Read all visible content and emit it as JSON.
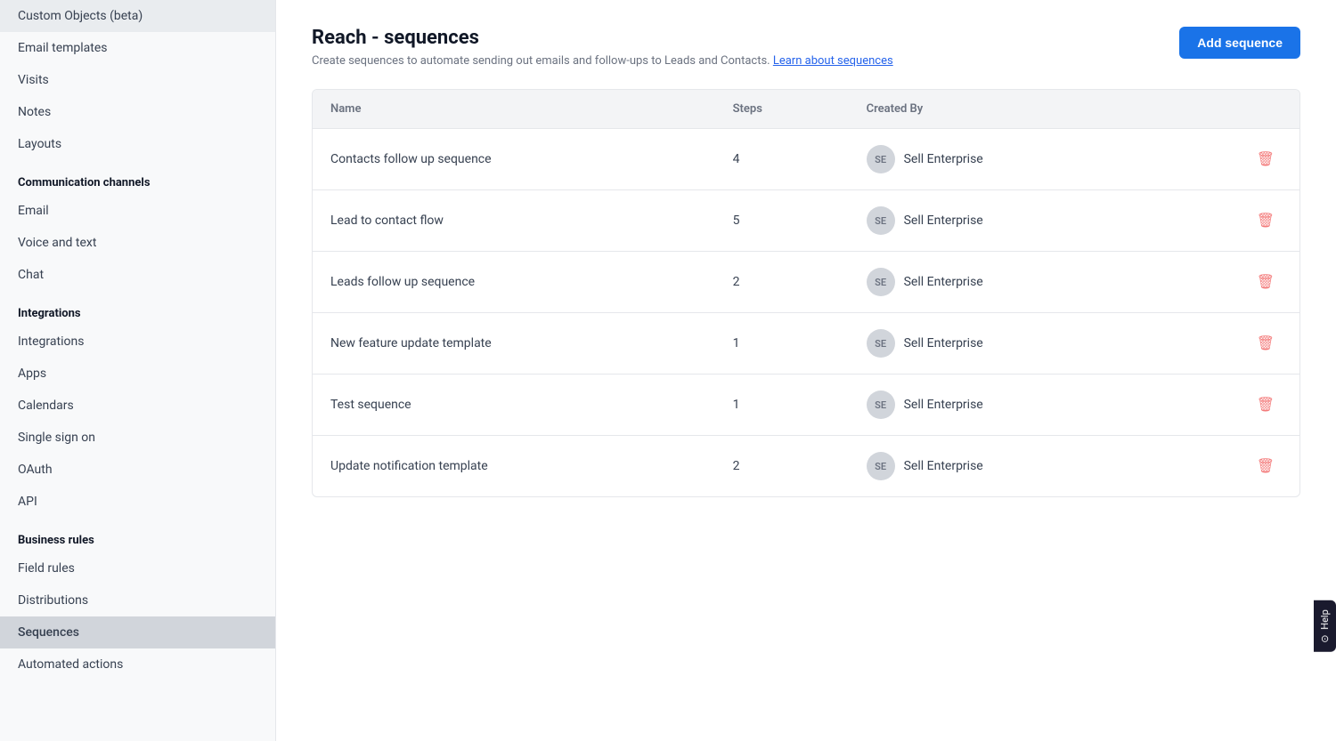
{
  "sidebar": {
    "items_top": [
      {
        "id": "custom-objects",
        "label": "Custom Objects (beta)",
        "active": false
      },
      {
        "id": "email-templates",
        "label": "Email templates",
        "active": false
      },
      {
        "id": "visits",
        "label": "Visits",
        "active": false
      },
      {
        "id": "notes",
        "label": "Notes",
        "active": false
      },
      {
        "id": "layouts",
        "label": "Layouts",
        "active": false
      }
    ],
    "sections": [
      {
        "id": "communication-channels",
        "label": "Communication channels",
        "items": [
          {
            "id": "email",
            "label": "Email",
            "active": false
          },
          {
            "id": "voice-and-text",
            "label": "Voice and text",
            "active": false
          },
          {
            "id": "chat",
            "label": "Chat",
            "active": false
          }
        ]
      },
      {
        "id": "integrations",
        "label": "Integrations",
        "items": [
          {
            "id": "integrations",
            "label": "Integrations",
            "active": false
          },
          {
            "id": "apps",
            "label": "Apps",
            "active": false
          },
          {
            "id": "calendars",
            "label": "Calendars",
            "active": false
          },
          {
            "id": "single-sign-on",
            "label": "Single sign on",
            "active": false
          },
          {
            "id": "oauth",
            "label": "OAuth",
            "active": false
          },
          {
            "id": "api",
            "label": "API",
            "active": false
          }
        ]
      },
      {
        "id": "business-rules",
        "label": "Business rules",
        "items": [
          {
            "id": "field-rules",
            "label": "Field rules",
            "active": false
          },
          {
            "id": "distributions",
            "label": "Distributions",
            "active": false
          },
          {
            "id": "sequences",
            "label": "Sequences",
            "active": true
          },
          {
            "id": "automated-actions",
            "label": "Automated actions",
            "active": false
          }
        ]
      }
    ]
  },
  "page": {
    "title": "Reach - sequences",
    "description": "Create sequences to automate sending out emails and follow-ups to Leads and Contacts.",
    "learn_link_text": "Learn about sequences",
    "add_button_label": "Add sequence"
  },
  "table": {
    "columns": [
      {
        "id": "name",
        "label": "Name"
      },
      {
        "id": "steps",
        "label": "Steps"
      },
      {
        "id": "created_by",
        "label": "Created By"
      }
    ],
    "rows": [
      {
        "id": 1,
        "name": "Contacts follow up sequence",
        "steps": "4",
        "created_by": "Sell Enterprise",
        "avatar_initials": "SE"
      },
      {
        "id": 2,
        "name": "Lead to contact flow",
        "steps": "5",
        "created_by": "Sell Enterprise",
        "avatar_initials": "SE"
      },
      {
        "id": 3,
        "name": "Leads follow up sequence",
        "steps": "2",
        "created_by": "Sell Enterprise",
        "avatar_initials": "SE"
      },
      {
        "id": 4,
        "name": "New feature update template",
        "steps": "1",
        "created_by": "Sell Enterprise",
        "avatar_initials": "SE"
      },
      {
        "id": 5,
        "name": "Test sequence",
        "steps": "1",
        "created_by": "Sell Enterprise",
        "avatar_initials": "SE"
      },
      {
        "id": 6,
        "name": "Update notification template",
        "steps": "2",
        "created_by": "Sell Enterprise",
        "avatar_initials": "SE"
      }
    ]
  },
  "help": {
    "label": "Help"
  }
}
